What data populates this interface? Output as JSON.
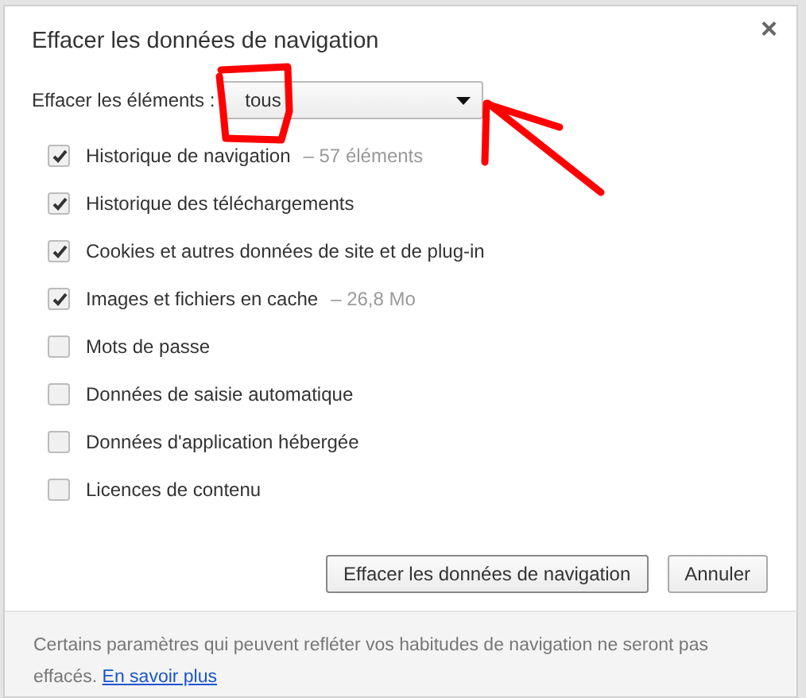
{
  "dialog": {
    "title": "Effacer les données de navigation",
    "close": "×"
  },
  "range": {
    "label": "Effacer les éléments :",
    "value": "tous"
  },
  "options": [
    {
      "label": "Historique de navigation",
      "detail": "–  57 éléments",
      "checked": true
    },
    {
      "label": "Historique des téléchargements",
      "checked": true
    },
    {
      "label": "Cookies et autres données de site et de plug-in",
      "checked": true
    },
    {
      "label": "Images et fichiers en cache",
      "detail": "–  26,8 Mo",
      "checked": true
    },
    {
      "label": "Mots de passe",
      "checked": false
    },
    {
      "label": "Données de saisie automatique",
      "checked": false
    },
    {
      "label": "Données d'application hébergée",
      "checked": false
    },
    {
      "label": "Licences de contenu",
      "checked": false
    }
  ],
  "buttons": [
    "Effacer les données de navigation",
    "Annuler"
  ],
  "footer": {
    "text": "Certains paramètres qui peuvent refléter vos habitudes de navigation ne seront pas effacés.",
    "link": "En savoir plus"
  }
}
